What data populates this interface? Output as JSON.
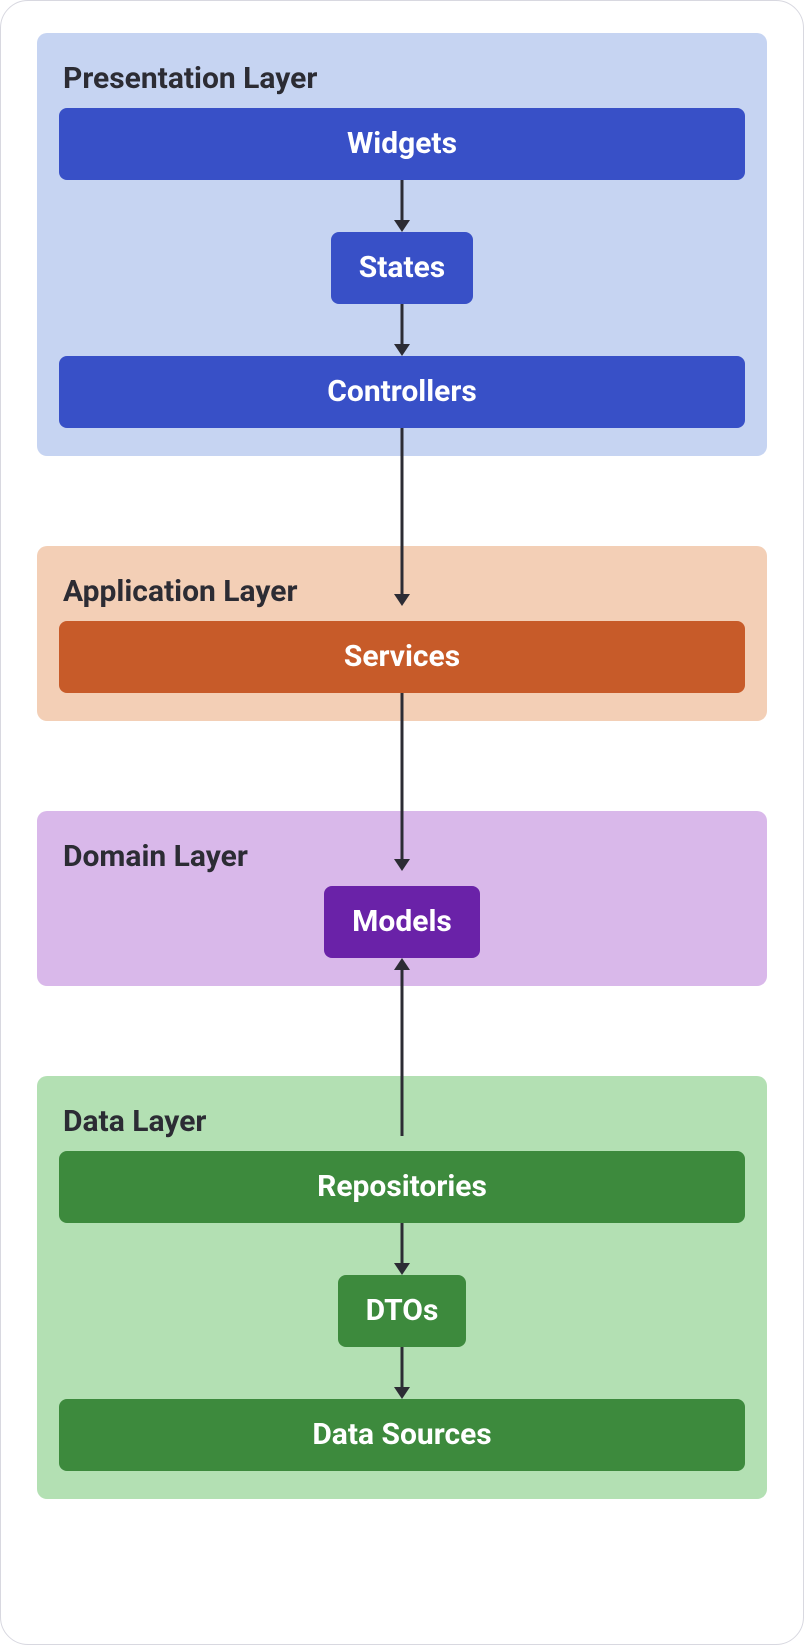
{
  "layers": {
    "presentation": {
      "title": "Presentation Layer",
      "boxes": {
        "widgets": "Widgets",
        "states": "States",
        "controllers": "Controllers"
      }
    },
    "application": {
      "title": "Application Layer",
      "boxes": {
        "services": "Services"
      }
    },
    "domain": {
      "title": "Domain Layer",
      "boxes": {
        "models": "Models"
      }
    },
    "data": {
      "title": "Data Layer",
      "boxes": {
        "repositories": "Repositories",
        "dtos": "DTOs",
        "data_sources": "Data Sources"
      }
    }
  },
  "colors": {
    "presentation_bg": "#c6d4f2",
    "application_bg": "#f3cfb6",
    "domain_bg": "#d9b8ea",
    "data_bg": "#b3e0b3",
    "blue": "#3850c7",
    "orange": "#c75b29",
    "purple": "#6a22a8",
    "green": "#3d8a3d",
    "arrow": "#2c2c34"
  },
  "flow": [
    {
      "from": "widgets",
      "to": "states",
      "bidirectional": false
    },
    {
      "from": "states",
      "to": "controllers",
      "bidirectional": false
    },
    {
      "from": "controllers",
      "to": "services",
      "bidirectional": false
    },
    {
      "from": "services",
      "to": "models",
      "bidirectional": false
    },
    {
      "from": "repositories",
      "to": "models",
      "bidirectional": false
    },
    {
      "from": "repositories",
      "to": "dtos",
      "bidirectional": false
    },
    {
      "from": "dtos",
      "to": "data_sources",
      "bidirectional": false
    }
  ]
}
